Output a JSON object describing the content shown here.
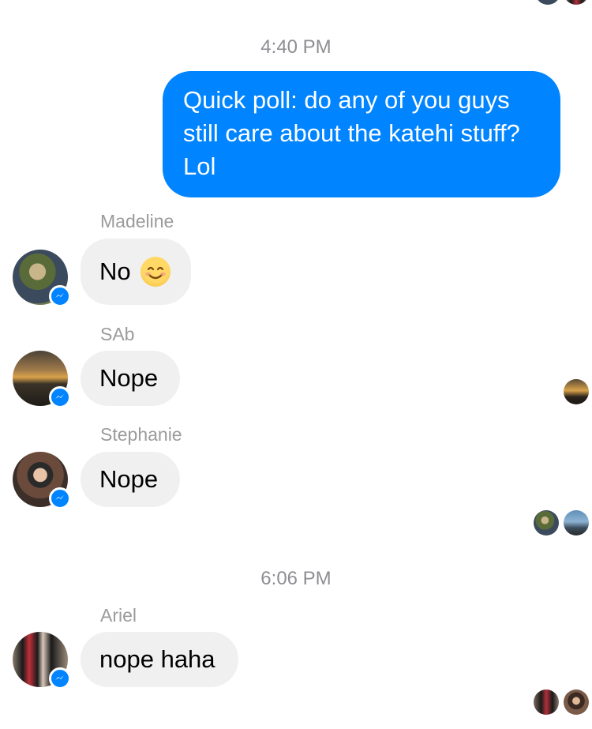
{
  "messages": {
    "timestamp_1": "4:40 PM",
    "outgoing_1": {
      "line1": "Quick poll: do any of you guys",
      "line2": "still care about the katehi stuff?",
      "line3": "Lol"
    },
    "madeline": {
      "sender": "Madeline",
      "text": "No",
      "emoji": "smiling-face-emoji"
    },
    "sab": {
      "sender": "SAb",
      "text": "Nope"
    },
    "stephanie": {
      "sender": "Stephanie",
      "text": "Nope"
    },
    "timestamp_2": "6:06 PM",
    "ariel": {
      "sender": "Ariel",
      "text": "nope haha"
    }
  },
  "icons": {
    "badge": "messenger-icon",
    "read_receipt": "read-receipt-avatar"
  },
  "colors": {
    "outgoing_bubble": "#0084ff",
    "incoming_bubble": "#f1f0f0",
    "meta_text": "#8e8e93"
  }
}
